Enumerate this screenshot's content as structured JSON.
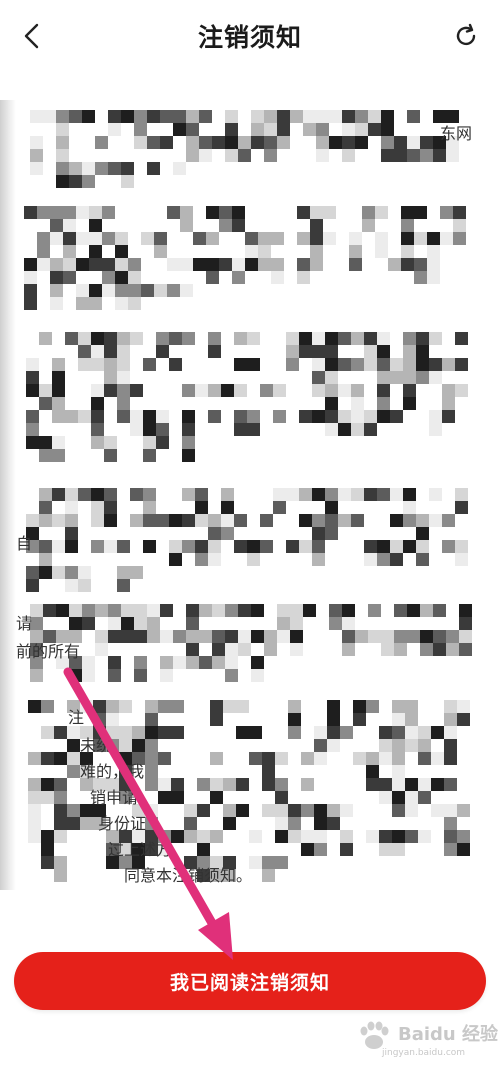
{
  "header": {
    "title": "注销须知",
    "back_icon": "chevron-left-icon",
    "refresh_icon": "refresh-icon"
  },
  "content": {
    "paragraphs": [
      {
        "visible_fragments": [
          "东网"
        ]
      },
      {
        "visible_fragments": []
      },
      {
        "visible_fragments": []
      },
      {
        "visible_fragments": [
          "自"
        ]
      },
      {
        "visible_fragments": [
          "请",
          "前的所有"
        ]
      },
      {
        "visible_fragments": [
          "注",
          "未统",
          "难的，我",
          "销申请，",
          "身份证",
          "过上述方",
          "同意本注销须知。"
        ]
      }
    ]
  },
  "cta_button": {
    "label": "我已阅读注销须知",
    "color": "#e5211a"
  },
  "annotation": {
    "arrow_color": "#e0307a"
  },
  "watermark": {
    "brand": "Baidu 经验",
    "url": "jingyan.baidu.com"
  }
}
